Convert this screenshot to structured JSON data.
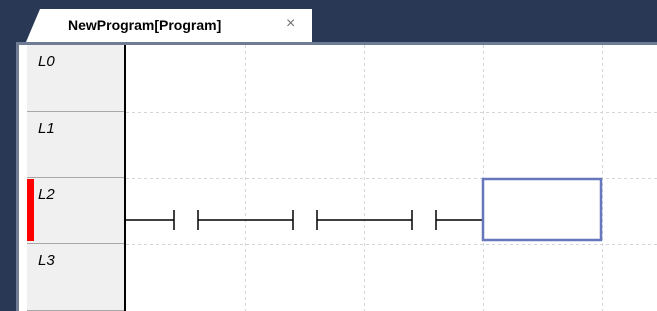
{
  "tab": {
    "title": "NewProgram[Program]",
    "close_glyph": "×"
  },
  "rungs": [
    {
      "label": "L0",
      "selected": false
    },
    {
      "label": "L1",
      "selected": false
    },
    {
      "label": "L2",
      "selected": true
    },
    {
      "label": "L3",
      "selected": false
    }
  ],
  "rung_l2": {
    "contacts": 3,
    "coil": "empty-output-box"
  },
  "colors": {
    "tabbar": "#293955",
    "marker": "#ff0000",
    "coil_border": "#6677bb",
    "grid": "#d6d6d6"
  }
}
